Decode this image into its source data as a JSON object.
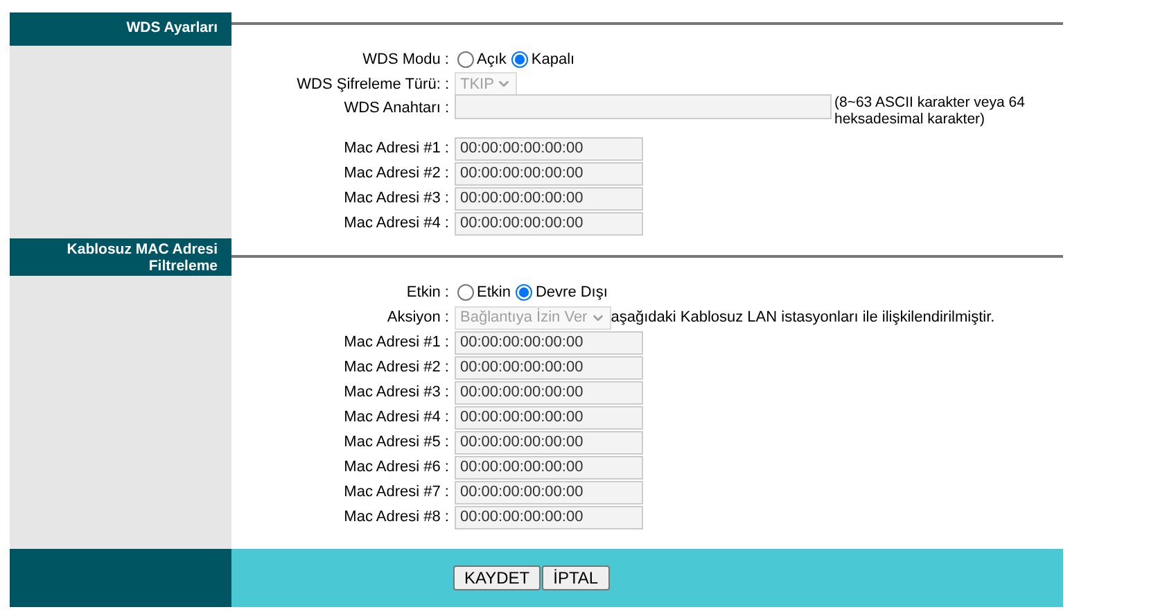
{
  "wds": {
    "title": "WDS Ayarları",
    "mode": {
      "label": "WDS Modu :",
      "options": [
        {
          "label": "Açık",
          "selected": false
        },
        {
          "label": "Kapalı",
          "selected": true
        }
      ]
    },
    "encryption": {
      "label": "WDS Şifreleme Türü: :",
      "value": "TKIP",
      "disabled": true
    },
    "key": {
      "label": "WDS Anahtarı :",
      "hint": "(8~63 ASCII karakter veya 64 heksadesimal karakter)"
    },
    "macs": [
      {
        "label": "Mac Adresi #1 :",
        "value": "00:00:00:00:00:00"
      },
      {
        "label": "Mac Adresi #2 :",
        "value": "00:00:00:00:00:00"
      },
      {
        "label": "Mac Adresi #3 :",
        "value": "00:00:00:00:00:00"
      },
      {
        "label": "Mac Adresi #4 :",
        "value": "00:00:00:00:00:00"
      }
    ]
  },
  "filter": {
    "title": "Kablosuz MAC Adresi Filtreleme",
    "enabled": {
      "label": "Etkin :",
      "options": [
        {
          "label": "Etkin",
          "selected": false
        },
        {
          "label": "Devre Dışı",
          "selected": true
        }
      ]
    },
    "action": {
      "label": "Aksiyon :",
      "value": "Bağlantıya İzin Ver",
      "disabled": true,
      "note": "aşağıdaki Kablosuz LAN istasyonları ile ilişkilendirilmiştir."
    },
    "macs": [
      {
        "label": "Mac Adresi #1 :",
        "value": "00:00:00:00:00:00"
      },
      {
        "label": "Mac Adresi #2 :",
        "value": "00:00:00:00:00:00"
      },
      {
        "label": "Mac Adresi #3 :",
        "value": "00:00:00:00:00:00"
      },
      {
        "label": "Mac Adresi #4 :",
        "value": "00:00:00:00:00:00"
      },
      {
        "label": "Mac Adresi #5 :",
        "value": "00:00:00:00:00:00"
      },
      {
        "label": "Mac Adresi #6 :",
        "value": "00:00:00:00:00:00"
      },
      {
        "label": "Mac Adresi #7 :",
        "value": "00:00:00:00:00:00"
      },
      {
        "label": "Mac Adresi #8 :",
        "value": "00:00:00:00:00:00"
      }
    ]
  },
  "buttons": [
    "KAYDET",
    "İPTAL"
  ]
}
